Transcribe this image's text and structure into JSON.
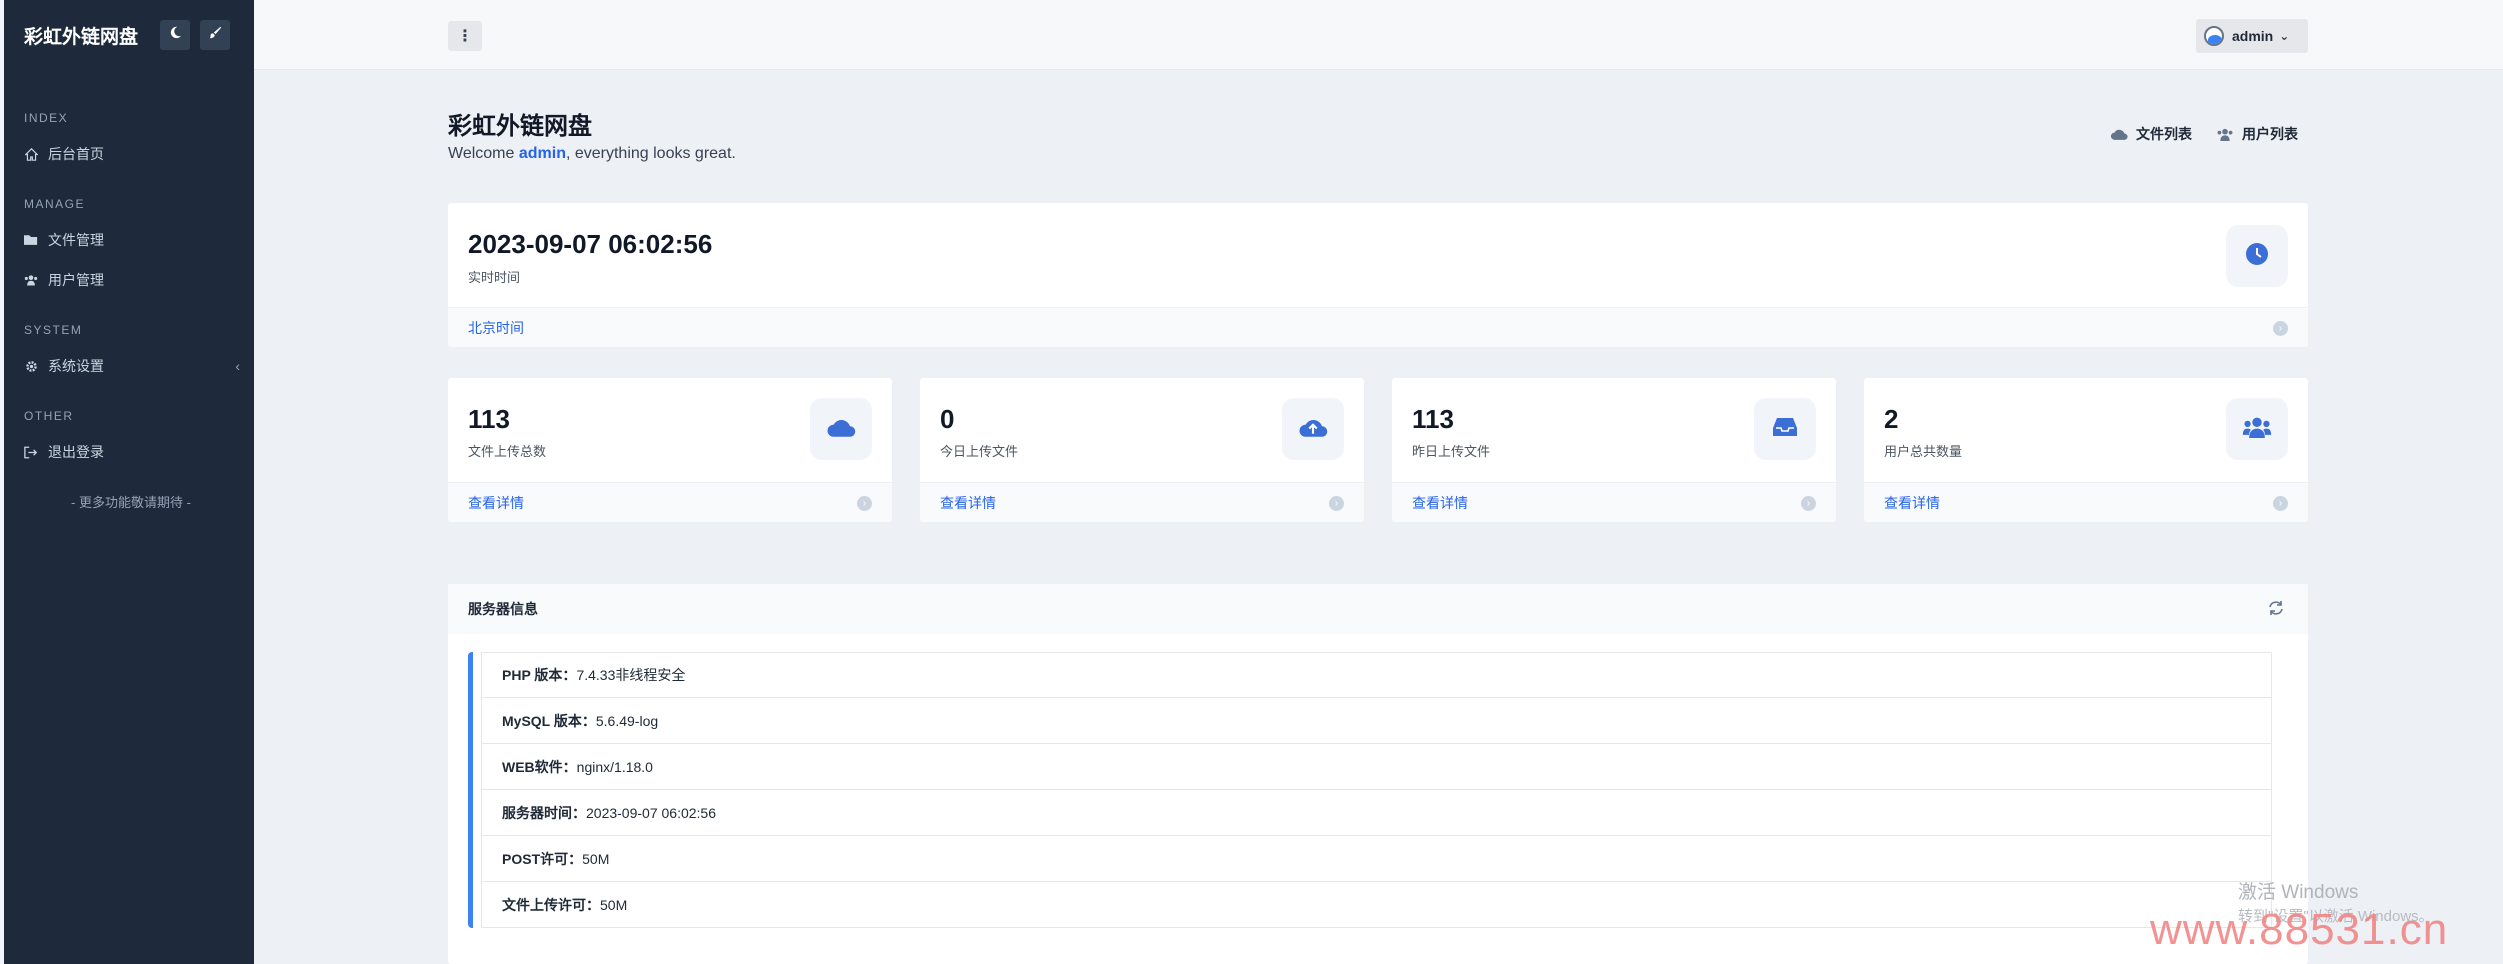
{
  "sidebar": {
    "brand": "彩虹外链网盘",
    "sections": [
      {
        "title": "INDEX",
        "items": [
          {
            "label": "后台首页",
            "icon": "home-icon"
          }
        ]
      },
      {
        "title": "MANAGE",
        "items": [
          {
            "label": "文件管理",
            "icon": "folder-icon"
          },
          {
            "label": "用户管理",
            "icon": "users-icon"
          }
        ]
      },
      {
        "title": "SYSTEM",
        "items": [
          {
            "label": "系统设置",
            "icon": "gear-icon",
            "chevron": "‹"
          }
        ]
      },
      {
        "title": "OTHER",
        "items": [
          {
            "label": "退出登录",
            "icon": "logout-icon"
          }
        ]
      }
    ],
    "more_text": "- 更多功能敬请期待 -"
  },
  "topbar": {
    "menu_glyph": "⋮",
    "user": "admin"
  },
  "page": {
    "title": "彩虹外链网盘",
    "welcome_prefix": "Welcome ",
    "welcome_user": "admin",
    "welcome_suffix": ", everything looks great.",
    "links": [
      "文件列表",
      "用户列表"
    ]
  },
  "time_card": {
    "value": "2023-09-07 06:02:56",
    "label": "实时时间",
    "footer": "北京时间"
  },
  "stats": [
    {
      "value": "113",
      "label": "文件上传总数",
      "footer": "查看详情",
      "icon": "cloud-icon"
    },
    {
      "value": "0",
      "label": "今日上传文件",
      "footer": "查看详情",
      "icon": "cloud-upload-icon"
    },
    {
      "value": "113",
      "label": "昨日上传文件",
      "footer": "查看详情",
      "icon": "inbox-icon"
    },
    {
      "value": "2",
      "label": "用户总共数量",
      "footer": "查看详情",
      "icon": "users-icon"
    }
  ],
  "server": {
    "title": "服务器信息",
    "rows": [
      {
        "k": "PHP 版本：",
        "v": "7.4.33非线程安全"
      },
      {
        "k": "MySQL 版本：",
        "v": "5.6.49-log"
      },
      {
        "k": "WEB软件：",
        "v": "nginx/1.18.0"
      },
      {
        "k": "服务器时间：",
        "v": "2023-09-07 06:02:56"
      },
      {
        "k": "POST许可：",
        "v": "50M"
      },
      {
        "k": "文件上传许可：",
        "v": "50M"
      }
    ]
  },
  "watermark": {
    "line1": "激活 Windows",
    "line2": "转到\"设置\"以激活 Windows。",
    "site": "www.88531.cn"
  },
  "colors": {
    "accent": "#2563eb",
    "sidebar": "#1e293b",
    "icon": "#3b6fd6"
  }
}
